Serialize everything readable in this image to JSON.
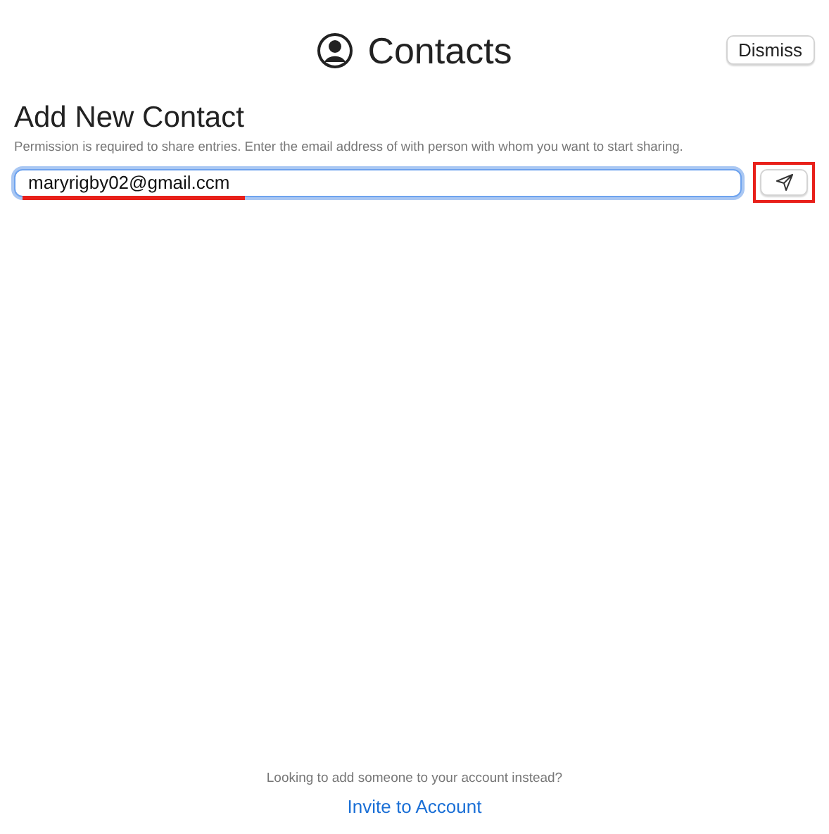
{
  "header": {
    "title": "Contacts",
    "dismiss_button": "Dismiss"
  },
  "form": {
    "heading": "Add New Contact",
    "description": "Permission is required to share entries. Enter the email address of with person with whom you want to start sharing.",
    "email_field": {
      "value": "maryrigby02@gmail.ccm",
      "focused": true,
      "highlighted": true
    },
    "send_button": {
      "highlighted": true
    }
  },
  "footer": {
    "prompt": "Looking to add someone to your account instead?",
    "link": "Invite to Account"
  }
}
